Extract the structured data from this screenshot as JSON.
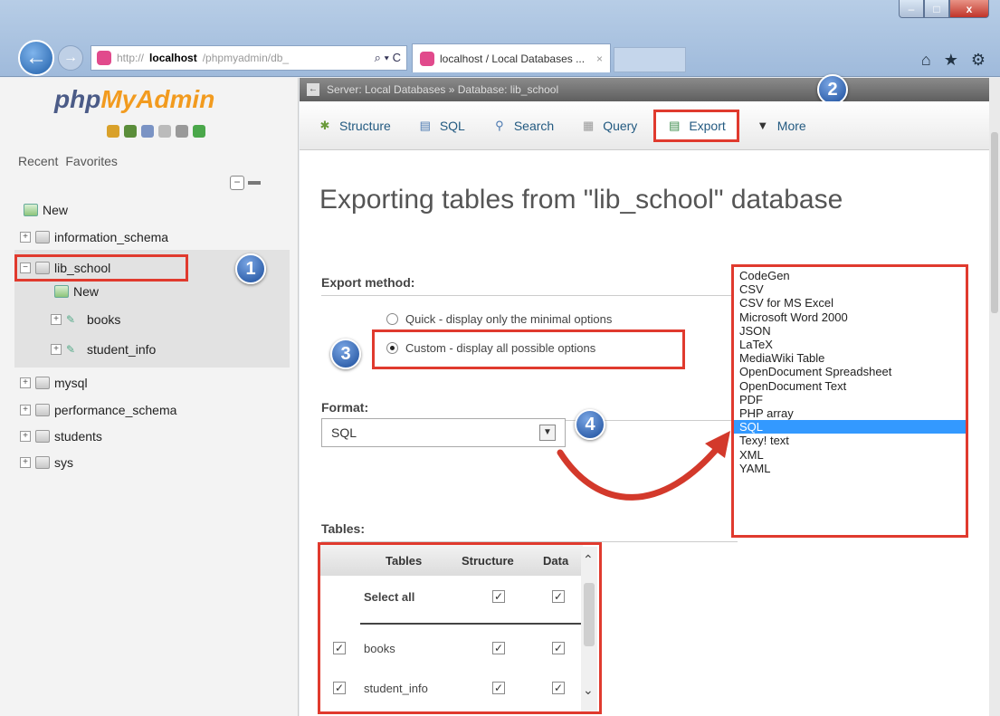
{
  "browser": {
    "address": {
      "proto": "http://",
      "host": "localhost",
      "path": "/phpmyadmin/db_",
      "tools": "⌕ ▾ C"
    },
    "tab_title": "localhost / Local Databases ...",
    "tab_close": "×",
    "back_icon": "←",
    "forward_icon": "→"
  },
  "sidebar": {
    "logo_php": "php",
    "logo_mya": "MyAdmin",
    "recent": "Recent",
    "favorites": "Favorites",
    "tree": [
      {
        "label": "New"
      },
      {
        "label": "information_schema"
      },
      {
        "label": "lib_school"
      },
      {
        "label": "New"
      },
      {
        "label": "books"
      },
      {
        "label": "student_info"
      },
      {
        "label": "mysql"
      },
      {
        "label": "performance_schema"
      },
      {
        "label": "students"
      },
      {
        "label": "sys"
      }
    ]
  },
  "badges": {
    "one": "1",
    "two": "2",
    "three": "3",
    "four": "4"
  },
  "main": {
    "breadcrumb": "Server: Local Databases » Database: lib_school",
    "tabs": [
      {
        "label": "Structure",
        "icon": "structure-icon"
      },
      {
        "label": "SQL",
        "icon": "sql-icon"
      },
      {
        "label": "Search",
        "icon": "search-icon"
      },
      {
        "label": "Query",
        "icon": "query-icon"
      },
      {
        "label": "Export",
        "icon": "export-icon"
      },
      {
        "label": "More",
        "icon": "chevron-down-icon"
      }
    ],
    "title": "Exporting tables from \"lib_school\" database",
    "export_method_label": "Export method:",
    "quick_option": "Quick - display only the minimal options",
    "custom_option": "Custom - display all possible options",
    "format_label": "Format:",
    "format_selected": "SQL",
    "tables_label": "Tables:",
    "format_options": [
      "CodeGen",
      "CSV",
      "CSV for MS Excel",
      "Microsoft Word 2000",
      "JSON",
      "LaTeX",
      "MediaWiki Table",
      "OpenDocument Spreadsheet",
      "OpenDocument Text",
      "PDF",
      "PHP array",
      "SQL",
      "Texy! text",
      "XML",
      "YAML"
    ],
    "tables_table": {
      "headers": [
        "Tables",
        "Structure",
        "Data"
      ],
      "select_all": "Select all",
      "rows": [
        "books",
        "student_info"
      ]
    }
  },
  "colors": {
    "annotation_red": "#e03a2e",
    "badge_blue": "#1a4c9a",
    "selected_option": "#3399ff"
  }
}
